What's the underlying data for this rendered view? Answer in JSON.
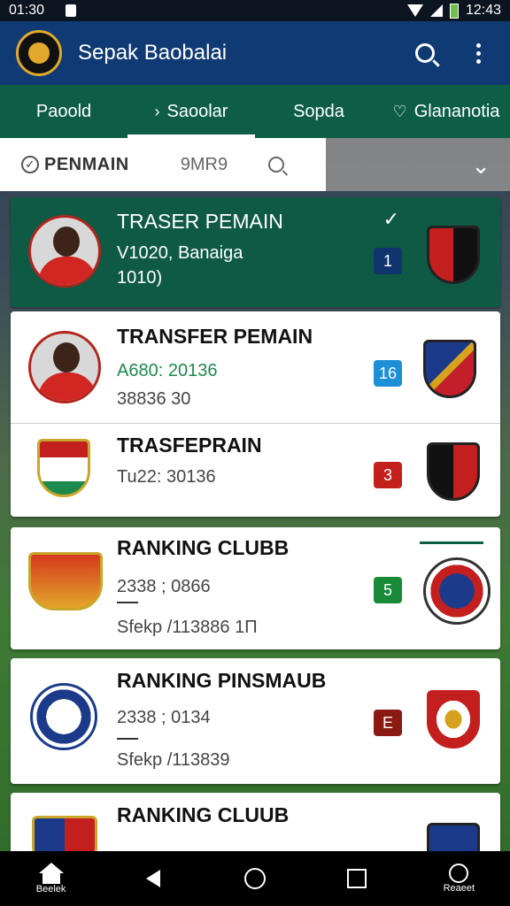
{
  "status": {
    "time": "01:30",
    "clock": "12:43"
  },
  "app": {
    "title": "Sepak Baobalai"
  },
  "tabs": [
    {
      "label": "Paoold"
    },
    {
      "label": "Saoolar",
      "prefix": "›"
    },
    {
      "label": "Sopda"
    },
    {
      "label": "Glananotia",
      "icon": "♡"
    }
  ],
  "filter": {
    "label": "PENMAIN",
    "sort": "9MR9"
  },
  "cards": [
    {
      "title": "TRASER PEMAIN",
      "line1": "V1020, Banaiga",
      "line2": "1010)",
      "badge": "1",
      "badge_color": "#10356e"
    },
    {
      "title": "TRANSFER PEMAIN",
      "line1": "A680: 20136",
      "line2": "38836 30",
      "badge": "16",
      "badge_color": "#1d8fd6"
    },
    {
      "title": "TRASFEPRAIN",
      "line1": "Tu22: 30136",
      "badge": "3",
      "badge_color": "#c3201c"
    },
    {
      "title": "RANKING CLUBB",
      "line1": "2338 ; 0866",
      "line2": "Sfekp  /113886 1П",
      "badge": "5",
      "badge_color": "#198a37"
    },
    {
      "title": "RANKING PINSMAUB",
      "line1": "2338 ; 0134",
      "line2": "Sfekp  /113839",
      "badge": "E",
      "badge_color": "#8b1a12"
    },
    {
      "title": "RANKING CLUUB"
    }
  ],
  "nav": {
    "home_label": "Beelek",
    "chat_label": "Reaeet"
  }
}
